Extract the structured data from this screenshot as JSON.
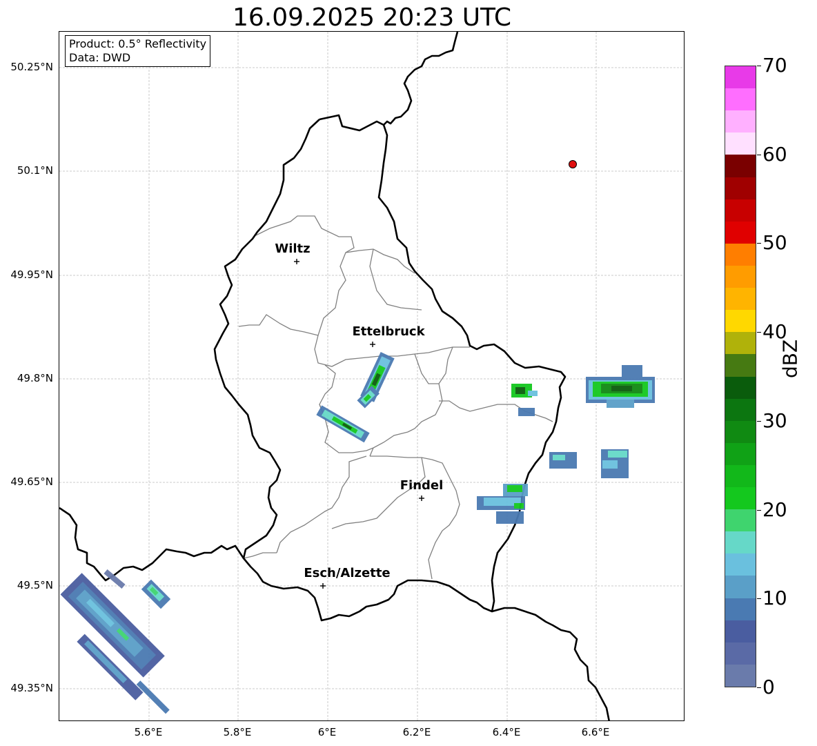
{
  "title": "16.09.2025 20:23 UTC",
  "info": {
    "product": "Product: 0.5° Reflectivity",
    "data_source": "Data: DWD"
  },
  "latitude_labels": [
    "50.25°N",
    "50.1°N",
    "49.95°N",
    "49.8°N",
    "49.65°N",
    "49.5°N",
    "49.35°N"
  ],
  "longitude_labels": [
    "5.6°E",
    "5.8°E",
    "6°E",
    "6.2°E",
    "6.4°E",
    "6.6°E"
  ],
  "cities": [
    {
      "name": "Wiltz",
      "lon": 5.93,
      "lat": 49.97
    },
    {
      "name": "Ettelbruck",
      "lon": 6.1,
      "lat": 49.85
    },
    {
      "name": "Findel",
      "lon": 6.21,
      "lat": 49.63
    },
    {
      "name": "Esch/Alzette",
      "lon": 5.99,
      "lat": 49.5
    }
  ],
  "radar_site": {
    "lon": 6.55,
    "lat": 50.11,
    "color": "#e01010"
  },
  "colorbar": {
    "label": "dBZ",
    "range": [
      0,
      70
    ],
    "tick_labels": [
      "0",
      "10",
      "20",
      "30",
      "40",
      "50",
      "60",
      "70"
    ],
    "colors": [
      "#6a7bab",
      "#5a6aa6",
      "#4a5da0",
      "#4a7ab2",
      "#5a9fc8",
      "#6ac0de",
      "#66d8c8",
      "#3fd46e",
      "#14c81e",
      "#12b81a",
      "#10a216",
      "#108a12",
      "#0c7610",
      "#0a5c0c",
      "#467a12",
      "#b0b20a",
      "#ffd800",
      "#ffb400",
      "#ff9c00",
      "#ff7e00",
      "#e00000",
      "#c80000",
      "#a00000",
      "#7a0000",
      "#ffe0ff",
      "#ffb0ff",
      "#ff6eff",
      "#e83ae8"
    ]
  }
}
